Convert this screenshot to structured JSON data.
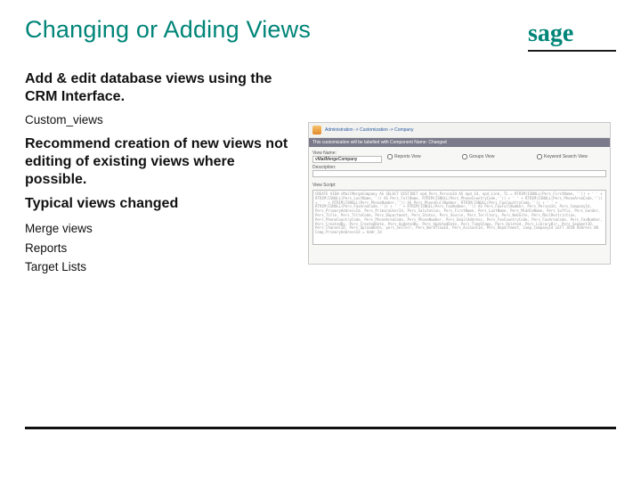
{
  "title": "Changing or Adding Views",
  "logo": {
    "text": "sage",
    "color": "#008578"
  },
  "left": {
    "subtitle": "Add & edit database views using the CRM Interface.",
    "small": "Custom_views",
    "rec": "Recommend creation of new views not editing of existing views where possible.",
    "typ": "Typical views changed",
    "items": [
      "Merge views",
      "Reports",
      "Target Lists"
    ]
  },
  "shot": {
    "breadcrumb": "Administration -> Customization -> Company",
    "bar": "This customization will be labelled with Component Name: Changed",
    "fields": {
      "view_name_label": "View Name:",
      "view_name_value": "vMailMergeCompany",
      "reports_label": "Reports View",
      "groups_label": "Groups View",
      "keyword_label": "Keyword Search View",
      "desc_label": "Description:",
      "desc_value": ""
    },
    "script_label": "View Script:",
    "script_value": "CREATE VIEW vMailMergeCompany AS SELECT DISTINCT epd_Pers_PersonId AS epd_Id, epd_Link, TL = RTRIM(ISNULL(Pers_FirstName, '')) + ' ' + RTRIM(ISNULL(Pers_LastName,'')) AS Pers_FullName, RTRIM(ISNULL(Pers_PhoneCountryCode,'')) + ' ' + RTRIM(ISNULL(Pers_PhoneAreaCode,'')) + ' ' + RTRIM(ISNULL(Pers_PhoneNumber,'')) AS Pers_PhoneFullNumber, RTRIM(ISNULL(Pers_FaxCountryCode,'')) + ' ' + RTRIM(ISNULL(Pers_FaxAreaCode,'')) + ' ' + RTRIM(ISNULL(Pers_FaxNumber,'')) AS Pers_FaxFullNumber, Pers_PersonId, Pers_CompanyId, Pers_PrimaryAddressId, Pers_PrimaryUserId, Pers_Salutation, Pers_FirstName, Pers_LastName, Pers_MiddleName, Pers_Suffix, Pers_Gender, Pers_Title, Pers_TitleCode, Pers_Department, Pers_Status, Pers_Source, Pers_Territory, Pers_WebSite, Pers_MailRestriction, Pers_PhoneCountryCode, Pers_PhoneAreaCode, Pers_PhoneNumber, Pers_EmailAddress, Pers_FaxCountryCode, Pers_FaxAreaCode, Pers_FaxNumber, Pers_CreatedBy, Pers_CreatedDate, Pers_UpdatedBy, Pers_UpdatedDate, Pers_TimeStamp, Pers_Deleted, Pers_LibraryDir, Pers_SegmentID, Pers_ChannelID, Pers_UploadDate, pers_SecTerr, Pers_WorkflowId, Pers_AccountId, Pers_Department, Comp_CompanyId LEFT JOIN Address ON Comp_PrimaryAddressId = Addr_Id"
  }
}
